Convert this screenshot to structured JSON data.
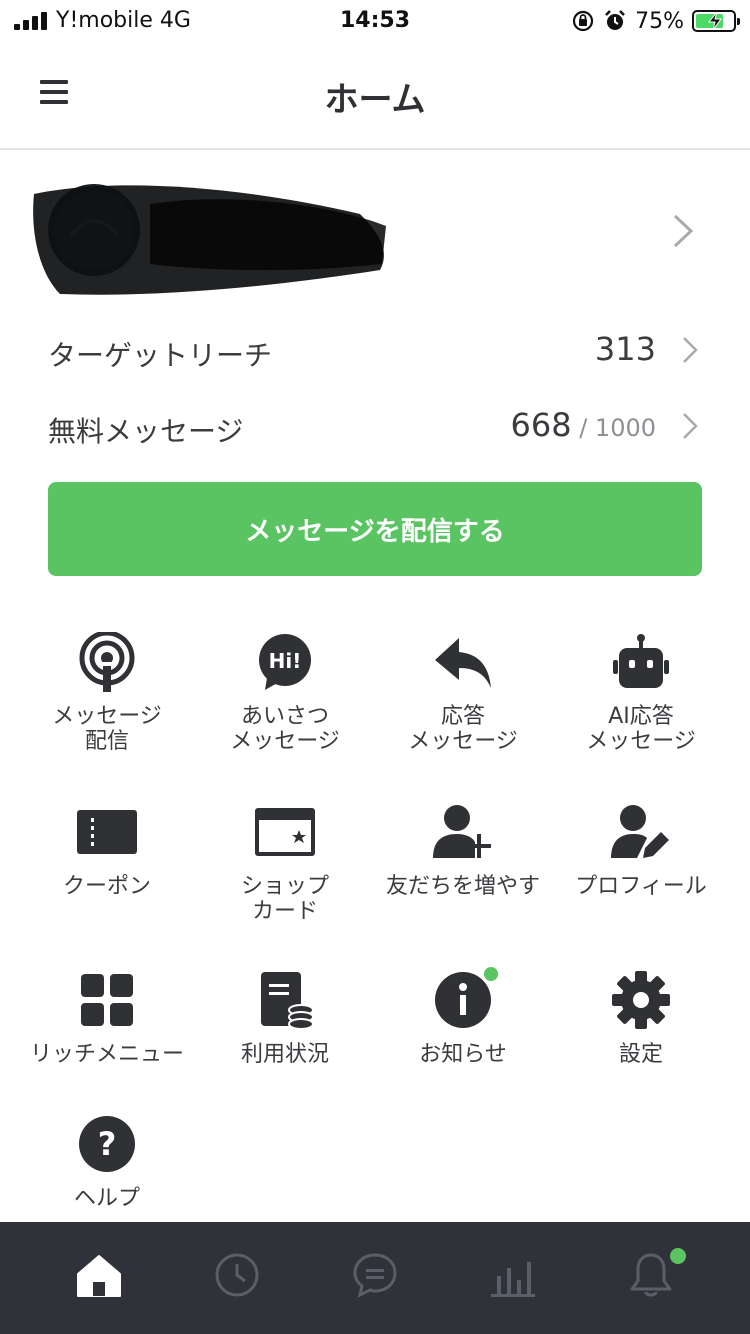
{
  "status_bar": {
    "carrier": "Y!mobile   4G",
    "time": "14:53",
    "battery": "75%",
    "battery_level": 0.75
  },
  "header": {
    "menu_icon": "hamburger-icon",
    "title": "ホーム"
  },
  "account": {
    "name_redacted": true
  },
  "stats": [
    {
      "label": "ターゲットリーチ",
      "value": "313",
      "sub": ""
    },
    {
      "label": "無料メッセージ",
      "value": "668",
      "sub": " / 1000"
    }
  ],
  "cta": {
    "label": "メッセージを配信する"
  },
  "grid": [
    {
      "icon": "broadcast-icon",
      "label": "メッセージ\n配信"
    },
    {
      "icon": "greeting-bubble-icon",
      "label": "あいさつ\nメッセージ"
    },
    {
      "icon": "reply-icon",
      "label": "応答\nメッセージ"
    },
    {
      "icon": "robot-icon",
      "label": "AI応答\nメッセージ"
    },
    {
      "icon": "coupon-icon",
      "label": "クーポン"
    },
    {
      "icon": "shop-card-icon",
      "label": "ショップ\nカード"
    },
    {
      "icon": "add-friend-icon",
      "label": "友だちを増やす"
    },
    {
      "icon": "profile-edit-icon",
      "label": "プロフィール"
    },
    {
      "icon": "rich-menu-icon",
      "label": "リッチメニュー"
    },
    {
      "icon": "usage-icon",
      "label": "利用状況"
    },
    {
      "icon": "info-icon",
      "label": "お知らせ"
    },
    {
      "icon": "gear-icon",
      "label": "設定"
    },
    {
      "icon": "help-icon",
      "label": "ヘルプ"
    }
  ],
  "tabbar": [
    {
      "icon": "home-icon",
      "active": true
    },
    {
      "icon": "clock-icon",
      "active": false
    },
    {
      "icon": "chat-icon",
      "active": false
    },
    {
      "icon": "chart-icon",
      "active": false
    },
    {
      "icon": "bell-icon",
      "active": false
    }
  ],
  "colors": {
    "accent": "#5ac463",
    "text": "#2f3134",
    "tabbar_bg": "#2f3238"
  }
}
